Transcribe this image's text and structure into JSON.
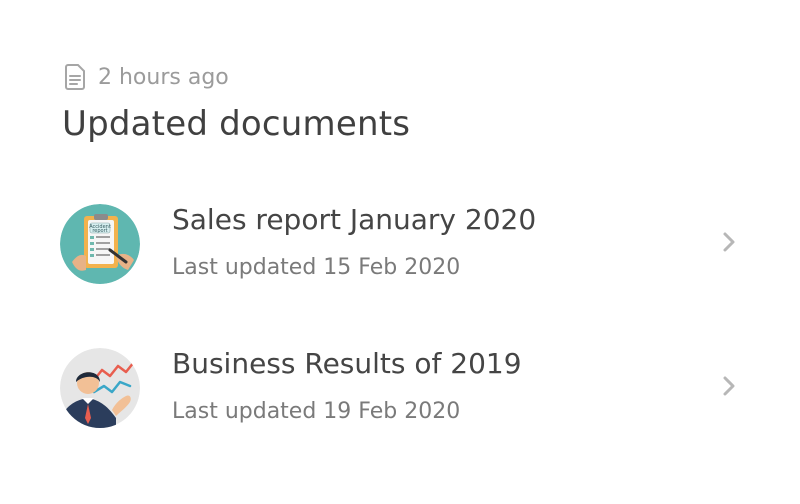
{
  "header": {
    "timestamp": "2 hours ago",
    "title": "Updated documents",
    "timestamp_icon": "document-icon"
  },
  "documents": [
    {
      "title": "Sales report January 2020",
      "subtitle": "Last updated 15 Feb 2020",
      "thumbnail": "accident-report-clipboard-image",
      "chevron": "chevron-right-icon",
      "thumb_bg": "#5fb7b0"
    },
    {
      "title": "Business Results of 2019",
      "subtitle": "Last updated 19 Feb 2020",
      "thumbnail": "businessman-chart-image",
      "chevron": "chevron-right-icon",
      "thumb_bg": "#e6e6e6"
    }
  ],
  "colors": {
    "meta": "#9b9b9b",
    "title": "#404040",
    "subtitle": "#7a7a7a",
    "chevron": "#b7b7b7"
  }
}
